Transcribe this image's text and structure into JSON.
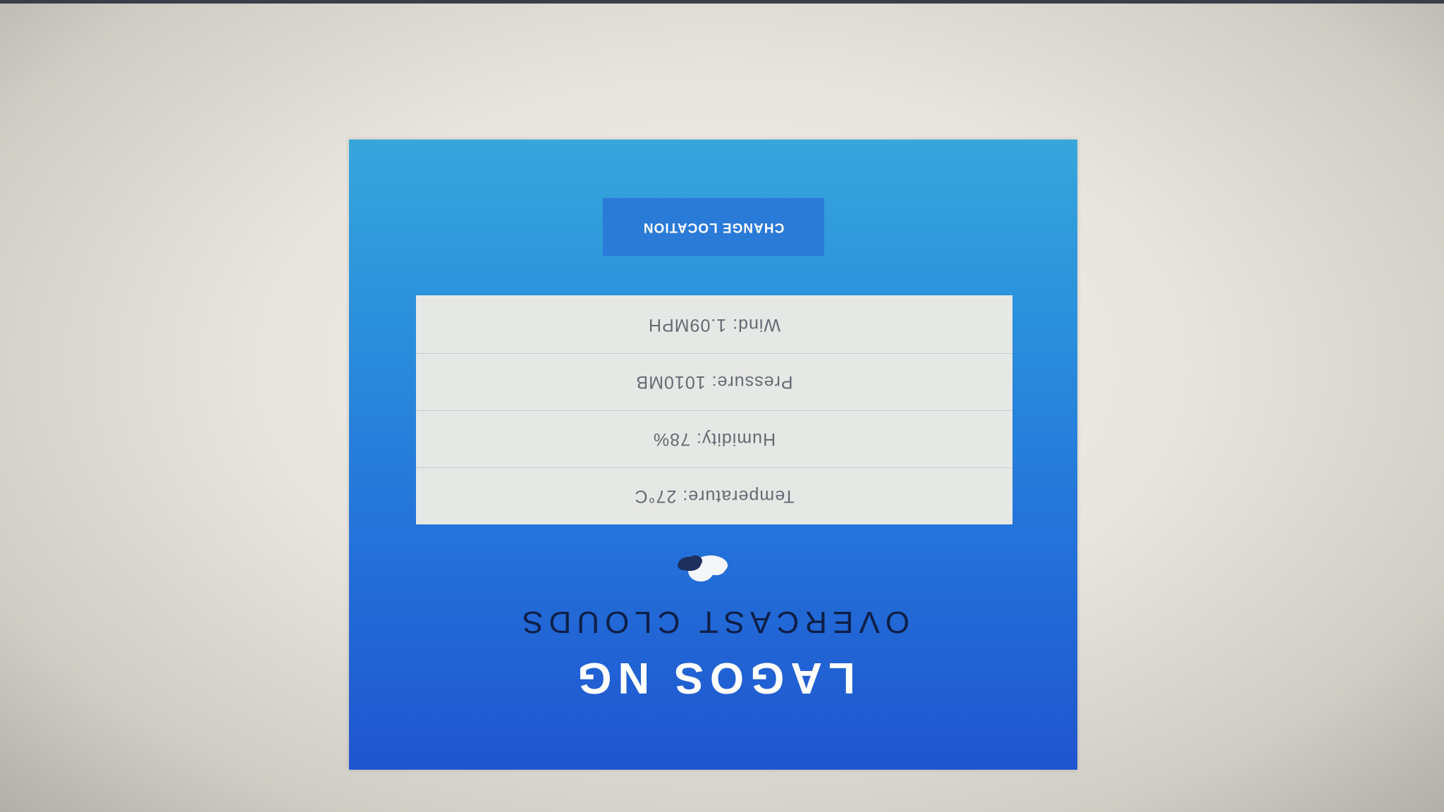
{
  "weather": {
    "location": "LAGOS NG",
    "condition": "OVERCAST CLOUDS",
    "icon": "cloud-icon",
    "details": [
      {
        "label": "Temperature: 27°C"
      },
      {
        "label": "Humidity: 78%"
      },
      {
        "label": "Pressure: 1010MB"
      },
      {
        "label": "Wind: 1.09MPH"
      }
    ],
    "change_location_label": "CHANGE LOCATION"
  },
  "colors": {
    "card_gradient_top": "#1f55cf",
    "card_gradient_bottom": "#36a6dc",
    "button": "#2a7ad8",
    "panel": "#e6e8e6",
    "condition_text": "#0e1f47"
  }
}
